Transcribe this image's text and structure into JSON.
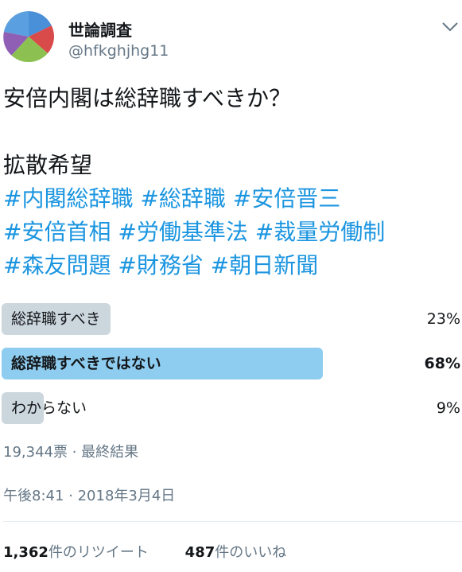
{
  "author": {
    "display_name": "世論調査",
    "handle": "@hfkghjhg11",
    "avatar_icon": "pie-chart-avatar",
    "avatar_colors": [
      "#4a90d9",
      "#d94a4a",
      "#8cc152",
      "#8e5fb5"
    ]
  },
  "menu_icon": "chevron-down-icon",
  "tweet": {
    "question": "安倍内閣は総辞職すべきか？",
    "request": "拡散希望",
    "hashtag_lines": [
      [
        "#内閣総辞職",
        "#総辞職",
        "#安倍晋三"
      ],
      [
        "#安倍首相",
        "#労働基準法",
        "#裁量労働制"
      ],
      [
        "#森友問題",
        "#財務省",
        "#朝日新聞"
      ]
    ]
  },
  "poll": {
    "options": [
      {
        "label": "総辞職すべき",
        "percent": 23,
        "percent_text": "23%",
        "winner": false
      },
      {
        "label": "総辞職すべきではない",
        "percent": 68,
        "percent_text": "68%",
        "winner": true
      },
      {
        "label": "わからない",
        "percent": 9,
        "percent_text": "9%",
        "winner": false
      }
    ],
    "meta": "19,344票 · 最終結果"
  },
  "timestamp": "午後8:41 · 2018年3月4日",
  "stats": {
    "retweets_count": "1,362",
    "retweets_label": "件のリツイート",
    "likes_count": "487",
    "likes_label": "件のいいね"
  },
  "colors": {
    "hashtag": "#1b95e0",
    "poll_winner": "#8fcdf0",
    "poll_other": "#ccd6dd",
    "secondary_text": "#657786"
  }
}
